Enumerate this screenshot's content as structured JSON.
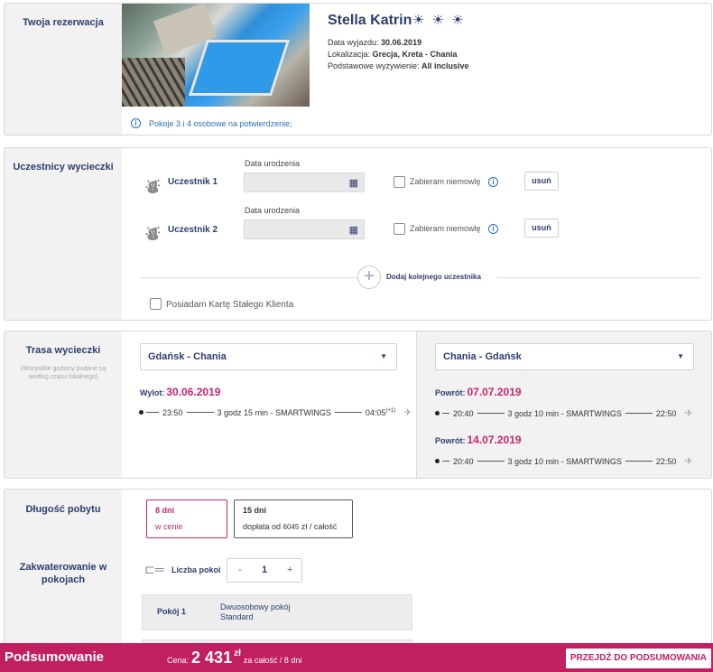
{
  "reservation": {
    "section_title": "Twoja rezerwacja",
    "hotel_name": "Stella Katrin",
    "stars_display": "☀ ☀ ☀",
    "departure_label": "Data wyjazdu: ",
    "departure_value": "30.06.2019",
    "location_label": "Lokalizacja: ",
    "location_value": "Grecja, Kreta - Chania",
    "board_label": "Podstawowe wyżywienie: ",
    "board_value": "All inclusive",
    "info_note": "Pokoje 3 i 4 osobowe na potwierdzenie;",
    "icons": {
      "info": "info-icon"
    }
  },
  "participants": {
    "section_title": "Uczestnicy wycieczki",
    "list": [
      {
        "name": "Uczestnik 1",
        "dob_label": "Data urodzenia",
        "dob_value": "",
        "infant_label": "Zabieram niemowlę",
        "remove_label": "usuń"
      },
      {
        "name": "Uczestnik 2",
        "dob_label": "Data urodzenia",
        "dob_value": "",
        "infant_label": "Zabieram niemowlę",
        "remove_label": "usuń"
      }
    ],
    "add_label": "Dodaj kolejnego uczestnika",
    "loyalty_label": "Posiadam Kartę Stałego Klienta",
    "icons": {
      "person": "person-icon",
      "calendar": "calendar-icon",
      "add": "plus-icon"
    }
  },
  "route": {
    "section_title": "Trasa wycieczki",
    "section_note": "(Wszystkie godziny podane są według czasu lokalnego)",
    "outbound": {
      "select_value": "Gdańsk - Chania",
      "flights": [
        {
          "label": "Wylot:",
          "date": "30.06.2019",
          "dep": "23:50",
          "duration": "3 godz 15 min - SMARTWINGS",
          "arr": "04:05",
          "arr_suffix": "(+1)"
        }
      ]
    },
    "inbound": {
      "select_value": "Chania - Gdańsk",
      "flights": [
        {
          "label": "Powrót:",
          "date": "07.07.2019",
          "dep": "20:40",
          "duration": "3 godz 10 min - SMARTWINGS",
          "arr": "22:50"
        },
        {
          "label": "Powrót:",
          "date": "14.07.2019",
          "dep": "20:40",
          "duration": "3 godz 10 min - SMARTWINGS",
          "arr": "22:50"
        }
      ]
    }
  },
  "stay": {
    "section_title": "Długość pobytu",
    "options": [
      {
        "days": "8 dni",
        "note": "w cenie",
        "selected": true
      },
      {
        "days": "15 dni",
        "note_prefix": "dopłata od ",
        "note_amount": "6045",
        "note_suffix": " zł / całość",
        "selected": false
      }
    ]
  },
  "accommodation": {
    "section_title": "Zakwaterowanie w pokojach",
    "rooms_label": "Liczba pokoi",
    "rooms_count": "1",
    "minus": "-",
    "plus": "+",
    "room_label": "Pokój 1",
    "room_type_line1": "Dwuosobowy pokój",
    "room_type_line2": "Standard"
  },
  "summary_bar": {
    "title": "Podsumowanie",
    "price_label": "Cena:",
    "price_value": "2 431",
    "currency": "zł",
    "price_note": "za całość / 8 dni",
    "button_label": "PRZEJDŹ DO PODSUMOWANIA"
  },
  "colors": {
    "accent": "#c0205f",
    "navy": "#2d3e6e",
    "link_blue": "#2a6fb0",
    "sidebar_bg": "#f2f2f2"
  }
}
